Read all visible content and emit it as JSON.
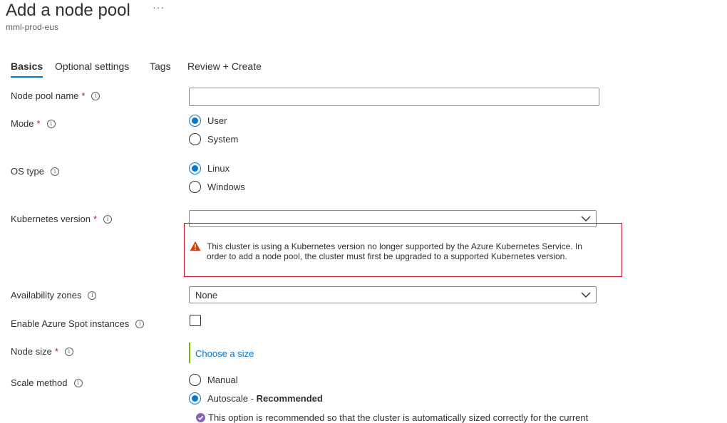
{
  "header": {
    "title": "Add a node pool",
    "more_icon": "ellipsis-icon",
    "more_label": "···",
    "subtitle": "mml-prod-eus"
  },
  "tabs": [
    {
      "label": "Basics",
      "active": true
    },
    {
      "label": "Optional settings",
      "active": false
    },
    {
      "label": "Tags",
      "active": false
    },
    {
      "label": "Review + Create",
      "active": false
    }
  ],
  "form": {
    "required_mark": "*",
    "info_glyph": "i",
    "node_pool_name": {
      "label": "Node pool name",
      "value": ""
    },
    "mode": {
      "label": "Mode",
      "options": [
        "User",
        "System"
      ],
      "selected": "User"
    },
    "os_type": {
      "label": "OS type",
      "options": [
        "Linux",
        "Windows"
      ],
      "selected": "Linux"
    },
    "kubernetes_version": {
      "label": "Kubernetes version",
      "value": "",
      "warning": "This cluster is using a Kubernetes version no longer supported by the Azure Kubernetes Service. In order to add a node pool, the cluster must first be upgraded to a supported Kubernetes version."
    },
    "availability_zones": {
      "label": "Availability zones",
      "value": "None"
    },
    "spot_instances": {
      "label": "Enable Azure Spot instances",
      "checked": false
    },
    "node_size": {
      "label": "Node size",
      "link": "Choose a size"
    },
    "scale_method": {
      "label": "Scale method",
      "options": [
        "Manual",
        "Autoscale"
      ],
      "recommended_sep": " - ",
      "recommended": "Recommended",
      "selected": "Autoscale",
      "note": "This option is recommended so that the cluster is automatically sized correctly for the current"
    }
  },
  "colors": {
    "accent": "#0078d4",
    "required": "#a4262c",
    "warning_border": "#c50f1f",
    "warning_icon": "#d83b01",
    "size_bar": "#7ab800",
    "recommend_icon": "#8764b8"
  },
  "icons": {
    "info": "info-icon",
    "dropdown": "chevron-down-icon",
    "warning": "warning-icon",
    "recommend": "recommend-badge-icon"
  }
}
